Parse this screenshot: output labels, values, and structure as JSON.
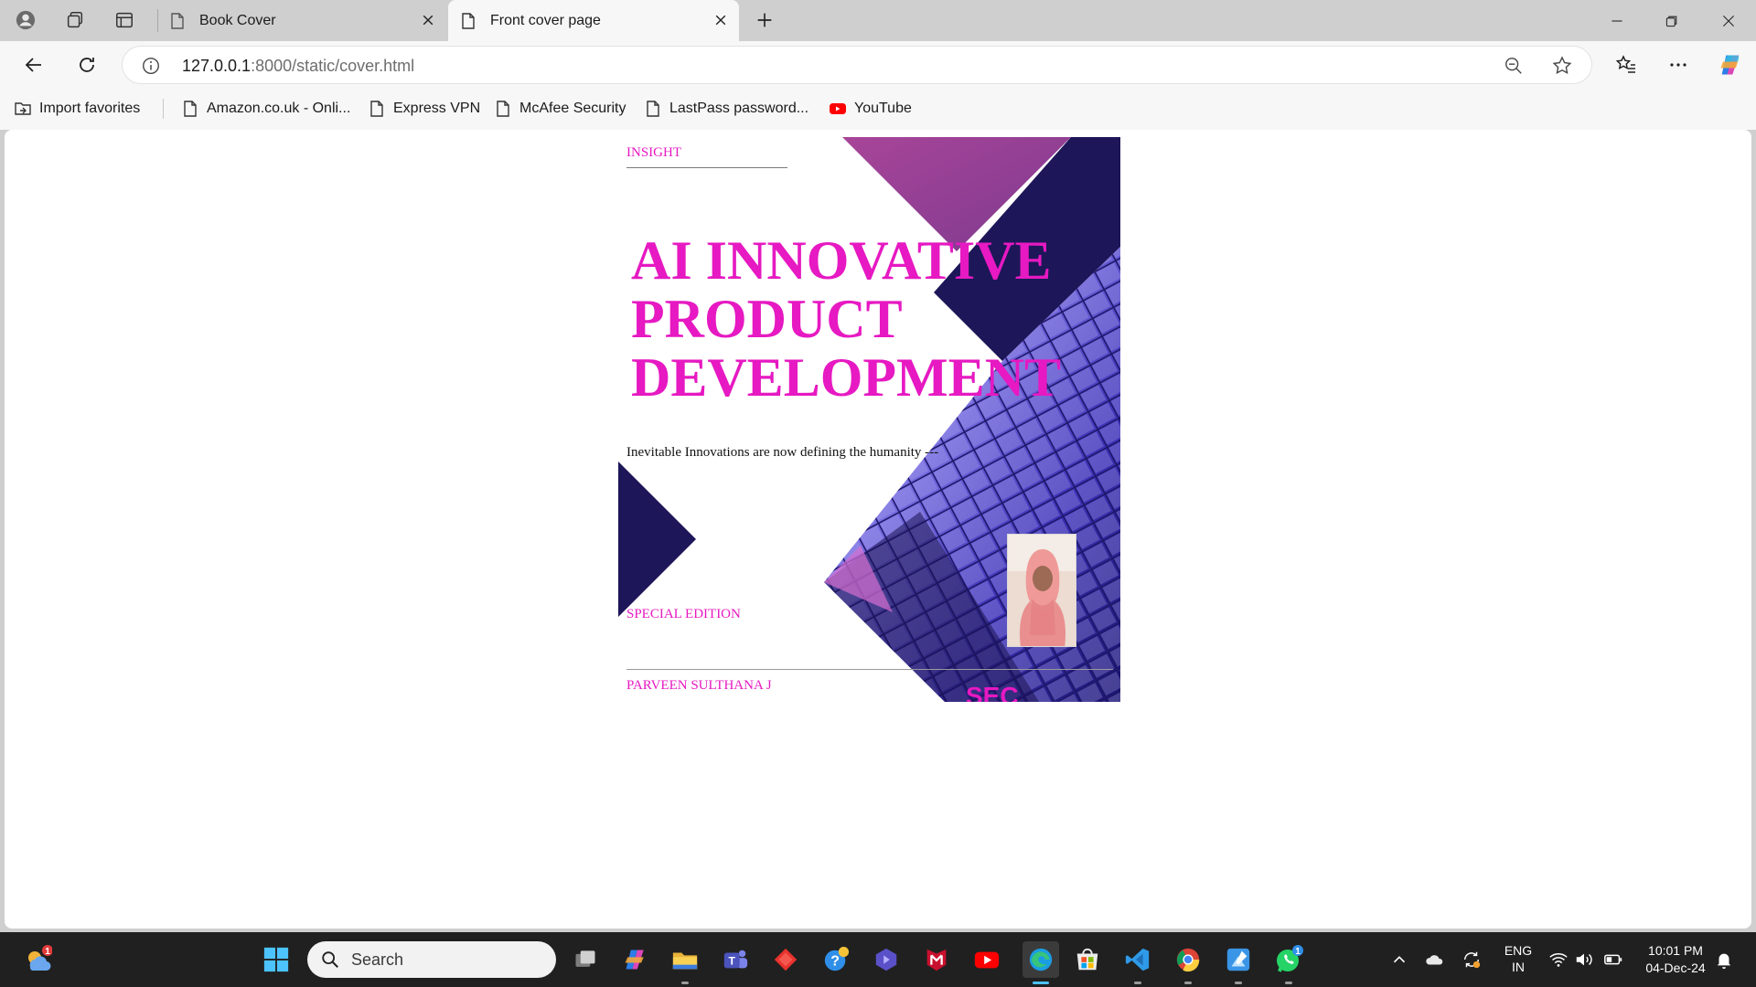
{
  "browser": {
    "tabs": [
      {
        "title": "Book Cover",
        "active": false
      },
      {
        "title": "Front cover page",
        "active": true
      }
    ],
    "address": {
      "host": "127.0.0.1",
      "rest": ":8000/static/cover.html"
    },
    "bookmarks": [
      {
        "label": "Import favorites",
        "icon": "import-favorites-icon"
      },
      {
        "label": "Amazon.co.uk - Onli...",
        "icon": "page-icon"
      },
      {
        "label": "Express VPN",
        "icon": "page-icon"
      },
      {
        "label": "McAfee Security",
        "icon": "page-icon"
      },
      {
        "label": "LastPass password...",
        "icon": "page-icon"
      },
      {
        "label": "YouTube",
        "icon": "youtube-icon"
      }
    ]
  },
  "cover": {
    "brand": "INSIGHT",
    "title_lines": [
      "AI INNOVATIVE",
      "PRODUCT",
      "DEVELOPMENT"
    ],
    "subtitle": "Inevitable Innovations are now defining the humanity ---",
    "edition": "SPECIAL EDITION",
    "author": "PARVEEN SULTHANA J",
    "logo": "SEC",
    "colors": {
      "accent": "#e619c2",
      "navy": "#1d1658",
      "magenta": "#9c3f8f",
      "glass": "#4b3ec2"
    }
  },
  "taskbar": {
    "search_placeholder": "Search",
    "weather_badge": "1",
    "whatsapp_badge": "1",
    "language": {
      "line1": "ENG",
      "line2": "IN"
    },
    "clock": {
      "time": "10:01 PM",
      "date": "04-Dec-24"
    }
  }
}
